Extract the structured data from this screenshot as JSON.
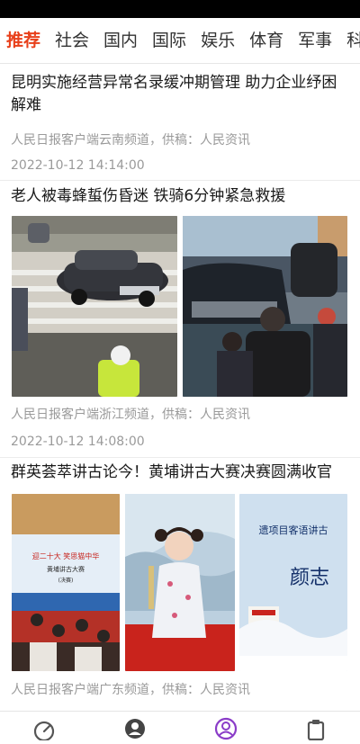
{
  "tabs": [
    "推荐",
    "社会",
    "国内",
    "国际",
    "娱乐",
    "体育",
    "军事",
    "科技"
  ],
  "articles": [
    {
      "title": "昆明实施经营异常名录缓冲期管理 助力企业纾困解难",
      "source": "人民日报客户端云南频道，供稿：人民资讯",
      "time": "2022-10-12 14:14:00"
    },
    {
      "title": "老人被毒蜂蜇伤昏迷 铁骑6分钟紧急救援",
      "source": "人民日报客户端浙江频道，供稿：人民资讯",
      "time": "2022-10-12 14:08:00"
    },
    {
      "title": "群英荟萃讲古论今！黄埔讲古大赛决赛圆满收官",
      "source": "人民日报客户端广东频道，供稿：人民资讯"
    }
  ],
  "image_text": {
    "banner_line1": "迎二十大 笑思猫中华",
    "banner_line2": "黄埔讲古大赛",
    "banner_line3": "(决赛)",
    "board_line1": "遗项目客语讲古",
    "board_line2": "颜志"
  },
  "colors": {
    "accent": "#e8401b",
    "nav_active": "#8a3cc8",
    "nav_inactive": "#555555"
  },
  "nav_icons": [
    "gauge-icon",
    "user-icon",
    "profile-icon",
    "clipboard-icon"
  ]
}
